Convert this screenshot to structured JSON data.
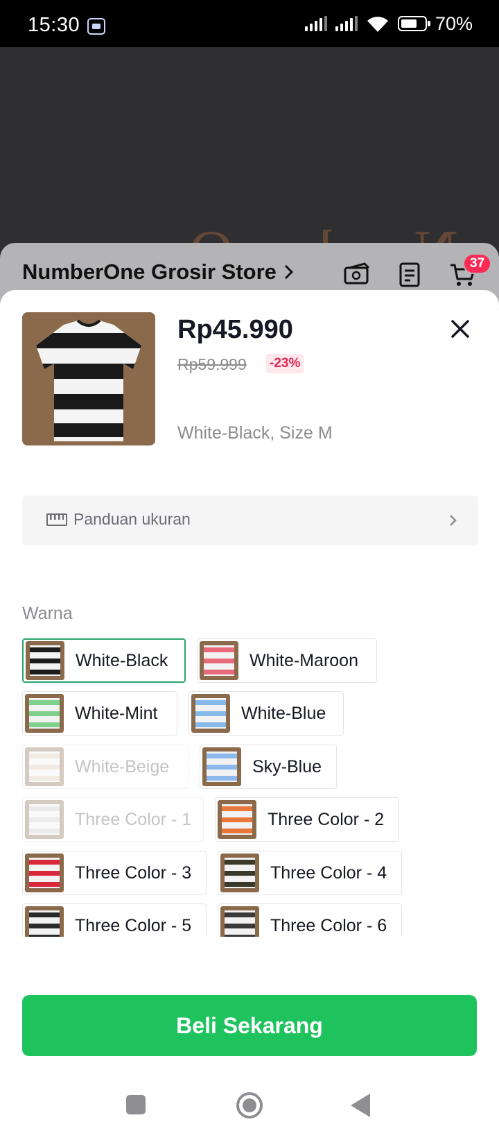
{
  "status_bar": {
    "time": "15:30",
    "battery_percent": "70%",
    "battery_level": 0.7
  },
  "background": {
    "sign_text": "Number One."
  },
  "store_bar": {
    "store_name": "NumberOne Grosir Store",
    "cart_count": "37"
  },
  "product": {
    "price": "Rp45.990",
    "original_price": "Rp59.999",
    "discount": "-23%",
    "selected_variant": "White-Black, Size M"
  },
  "size_guide": {
    "label": "Panduan ukuran"
  },
  "color_section": {
    "label": "Warna",
    "options": [
      {
        "label": "White-Black",
        "selected": true,
        "disabled": false,
        "accent": "#1c1c1c"
      },
      {
        "label": "White-Maroon",
        "selected": false,
        "disabled": false,
        "accent": "#e86a7a"
      },
      {
        "label": "White-Mint",
        "selected": false,
        "disabled": false,
        "accent": "#7fd08a"
      },
      {
        "label": "White-Blue",
        "selected": false,
        "disabled": false,
        "accent": "#86b8e8"
      },
      {
        "label": "White-Beige",
        "selected": false,
        "disabled": true,
        "accent": "#d8c8b0"
      },
      {
        "label": "Sky-Blue",
        "selected": false,
        "disabled": false,
        "accent": "#8cb8ec"
      },
      {
        "label": "Three Color - 1",
        "selected": false,
        "disabled": true,
        "accent": "#c8c8c8"
      },
      {
        "label": "Three Color - 2",
        "selected": false,
        "disabled": false,
        "accent": "#e8773a"
      },
      {
        "label": "Three Color - 3",
        "selected": false,
        "disabled": false,
        "accent": "#d8283a"
      },
      {
        "label": "Three Color - 4",
        "selected": false,
        "disabled": false,
        "accent": "#3a3a2c"
      },
      {
        "label": "Three Color - 5",
        "selected": false,
        "disabled": false,
        "accent": "#2a2a2a"
      },
      {
        "label": "Three Color - 6",
        "selected": false,
        "disabled": false,
        "accent": "#3a3a3a"
      }
    ]
  },
  "buy_button": {
    "label": "Beli Sekarang"
  },
  "colors": {
    "primary_green": "#1ec35e",
    "selected_border": "#26a66b",
    "discount_red": "#e1264f",
    "badge_red": "#fe2c55"
  }
}
